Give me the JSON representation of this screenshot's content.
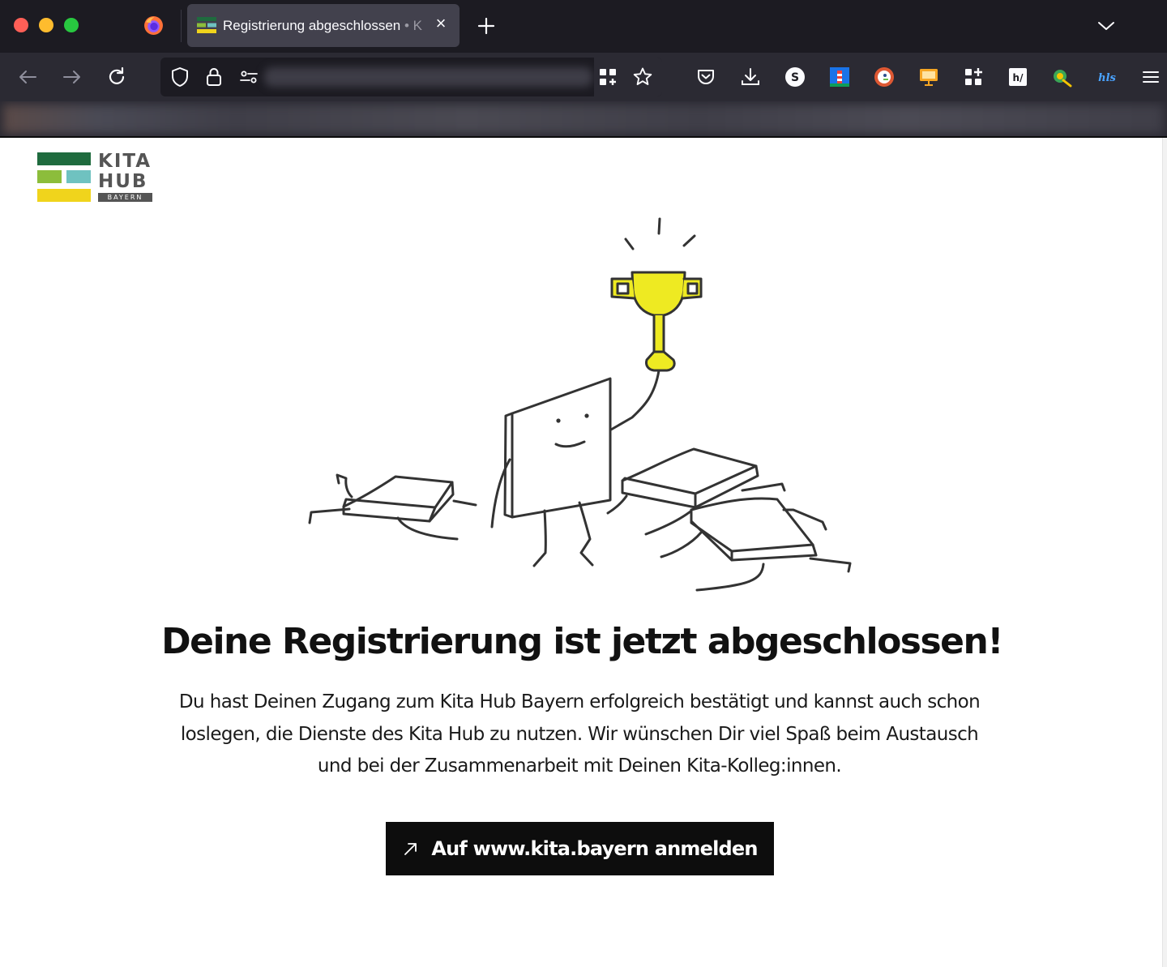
{
  "browser": {
    "tab": {
      "title": "Registrierung abgeschlossen",
      "title_suffix": " • K",
      "close_glyph": "×"
    }
  },
  "logo": {
    "line1": "KITA",
    "line2": "HUB",
    "line3": "BAYERN",
    "colors": {
      "dark_green": "#1f6b3e",
      "light_green": "#8cbd3b",
      "teal": "#6fc2c0",
      "yellow": "#f0d41c",
      "gray": "#555555"
    }
  },
  "main": {
    "headline": "Deine Registrierung ist jetzt abgeschlossen!",
    "body": "Du hast Deinen Zugang zum Kita Hub Bayern erfolgreich bestätigt und kannst auch schon loslegen, die Dienste des Kita Hub zu nutzen. Wir wünschen Dir viel Spaß beim Austausch und bei der Zusammenarbeit mit Deinen Kita-Kolleg:innen.",
    "cta_label": "Auf www.kita.bayern anmelden"
  },
  "icons": {
    "toolbar": [
      "back-icon",
      "forward-icon",
      "reload-icon",
      "shield-icon",
      "lock-icon",
      "permissions-icon",
      "extensions-grid-icon",
      "bookmark-star-icon",
      "pocket-icon",
      "download-icon",
      "extension-s-icon",
      "extension-lighthouse-icon",
      "duckduckgo-icon",
      "extension-presentation-icon",
      "add-extensions-icon",
      "hypothesis-icon",
      "extension-bird-icon",
      "extension-hls-icon",
      "menu-icon"
    ],
    "cta": "external-link-arrow-icon"
  }
}
